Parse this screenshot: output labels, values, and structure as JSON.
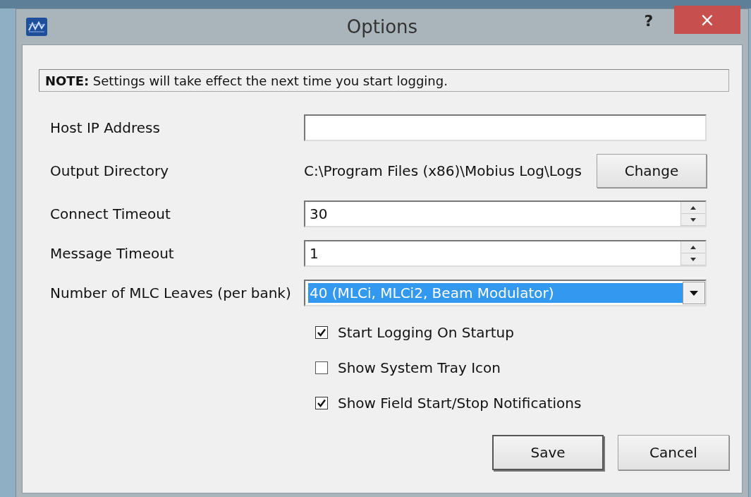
{
  "window": {
    "title": "Options",
    "help": "?",
    "close": "×"
  },
  "note": "**NOTE:** Settings will take effect the next time you start logging.",
  "fields": [
    {
      "kind": "text",
      "label": "Host IP Address"
    },
    {
      "kind": "path",
      "label": "Output Directory",
      "value": "C:\\Program Files (x86)\\Mobius Log\\Logs",
      "button": "Change"
    },
    {
      "kind": "spinner",
      "label": "Connect Timeout",
      "value": "30"
    },
    {
      "kind": "spinner",
      "label": "Message Timeout",
      "value": "1"
    },
    {
      "kind": "dropdown",
      "label": "Number of MLC Leaves (per bank)",
      "value": "40 (MLCi, MLCi2, Beam Modulator)",
      "selected": true
    }
  ],
  "checkboxes": [
    {
      "label": "Start Logging On Startup",
      "checked": true
    },
    {
      "label": "Show System Tray Icon",
      "checked": false
    },
    {
      "label": "Show Field Start/Stop Notifications",
      "checked": true
    }
  ],
  "buttons": [
    {
      "label": "Save",
      "default": true
    },
    {
      "label": "Cancel",
      "default": false
    }
  ]
}
